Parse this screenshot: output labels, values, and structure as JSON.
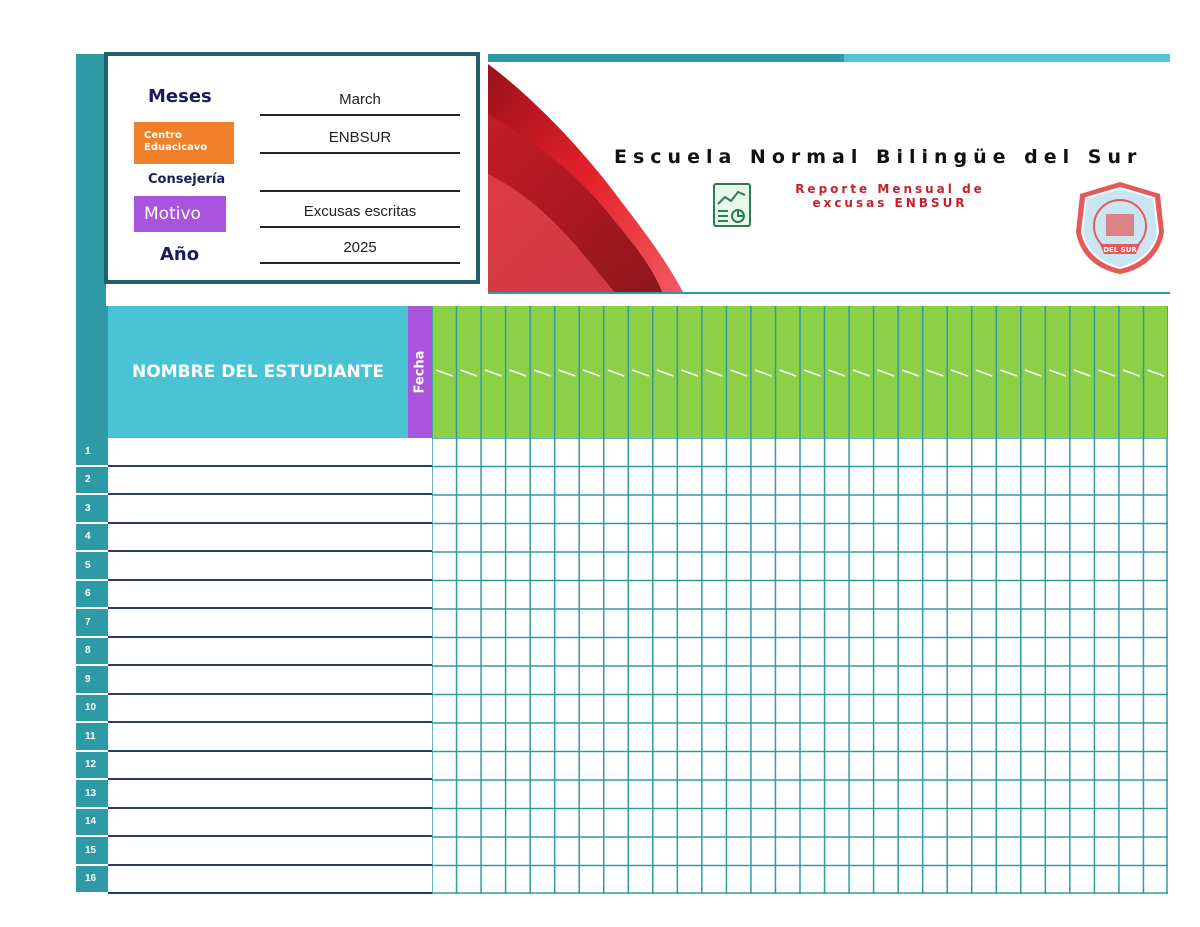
{
  "info": {
    "meses_label": "Meses",
    "centro_label": "Centro Eduacicavo",
    "consejeria_label": "Consejería",
    "motivo_label": "Motivo",
    "ano_label": "Año",
    "meses_value": "March",
    "centro_value": "ENBSUR",
    "consejeria_value": "",
    "motivo_value": "Excusas escritas",
    "ano_value": "2025"
  },
  "banner": {
    "school_name": "Escuela Normal Bilingüe del Sur",
    "report_title_line1": "Reporte Mensual de",
    "report_title_line2": "excusas ENBSUR",
    "report_icon": "chart-report-icon",
    "seal_icon": "school-seal-icon",
    "seal_text": "DEL SUR"
  },
  "table": {
    "name_header": "NOMBRE DEL ESTUDIANTE",
    "date_header": "Fecha",
    "date_columns": 30,
    "rows": [
      "1",
      "2",
      "3",
      "4",
      "5",
      "6",
      "7",
      "8",
      "9",
      "10",
      "11",
      "12",
      "13",
      "14",
      "15",
      "16"
    ]
  },
  "colors": {
    "teal": "#2e9aa6",
    "light_teal": "#4ac3d5",
    "purple": "#a954dc",
    "orange": "#f07f2a",
    "green": "#8cd048",
    "red": "#c8202a"
  }
}
